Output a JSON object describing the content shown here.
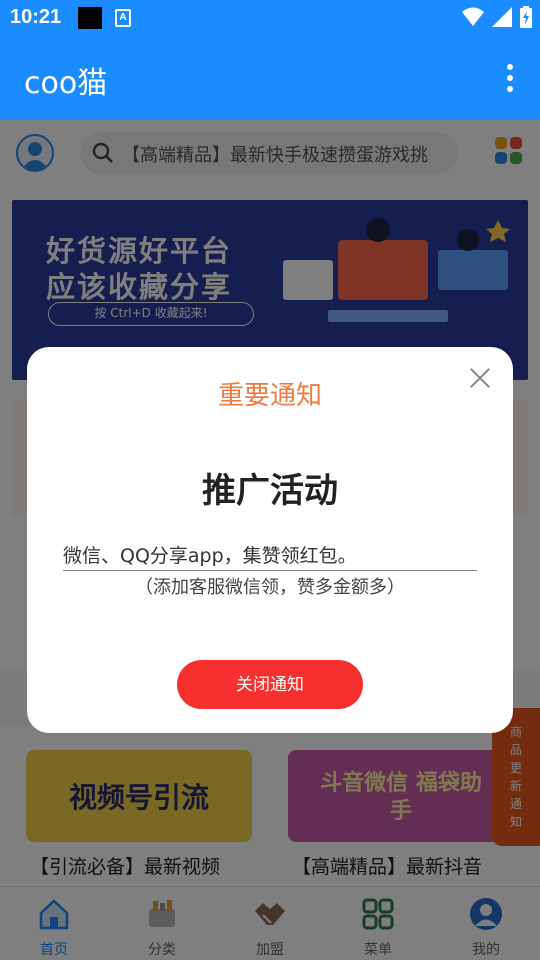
{
  "status_bar": {
    "time": "10:21",
    "notification_icon": "A"
  },
  "app_bar": {
    "title": "coo猫"
  },
  "search": {
    "text": "【高端精品】最新快手极速攒蛋游戏挑"
  },
  "banner": {
    "line1": "好货源好平台",
    "line2": "应该收藏分享",
    "pill": "按 Ctrl+D 收藏起来!"
  },
  "products": [
    {
      "image_text": "视频号引流",
      "title": "【引流必备】最新视频"
    },
    {
      "image_text": "斗音微信 福袋助手",
      "title": "【高端精品】最新抖音"
    }
  ],
  "side_tab": {
    "chars": [
      "商",
      "品",
      "更",
      "新",
      "通",
      "知"
    ]
  },
  "bottom_nav": [
    {
      "label": "首页",
      "icon": "home-icon",
      "active": true
    },
    {
      "label": "分类",
      "icon": "category-icon",
      "active": false
    },
    {
      "label": "加盟",
      "icon": "handshake-icon",
      "active": false
    },
    {
      "label": "菜单",
      "icon": "grid-icon",
      "active": false
    },
    {
      "label": "我的",
      "icon": "user-icon",
      "active": false
    }
  ],
  "dialog": {
    "title": "重要通知",
    "heading": "推广活动",
    "line1": "微信、QQ分享app，集赞领红包。",
    "line2": "（添加客服微信领，赞多金额多）",
    "button": "关闭通知"
  },
  "colors": {
    "primary": "#1a8cff",
    "dialog_title": "#f07a40",
    "button": "#f5302e",
    "side_tab": "#e8581e"
  }
}
